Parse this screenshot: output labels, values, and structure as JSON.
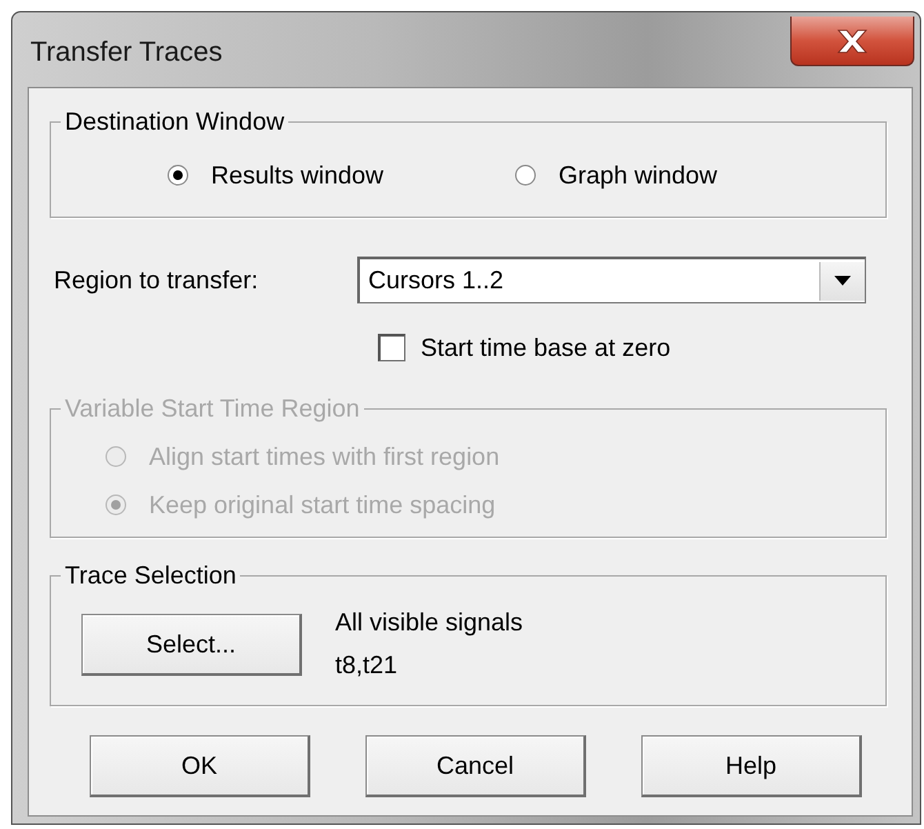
{
  "window": {
    "title": "Transfer Traces"
  },
  "destination_window": {
    "title": "Destination Window",
    "options": [
      {
        "label": "Results window",
        "selected": true
      },
      {
        "label": "Graph window",
        "selected": false
      }
    ]
  },
  "region": {
    "label": "Region to transfer:",
    "value": "Cursors 1..2"
  },
  "start_at_zero": {
    "label": "Start time base at zero",
    "checked": false
  },
  "variable_start": {
    "title": "Variable Start Time Region",
    "disabled": true,
    "options": [
      {
        "label": "Align start times with first region",
        "selected": false
      },
      {
        "label": "Keep original start time spacing",
        "selected": true
      }
    ]
  },
  "trace_selection": {
    "title": "Trace Selection",
    "button": "Select...",
    "description": "All visible signals",
    "traces": "t8,t21"
  },
  "buttons": [
    "OK",
    "Cancel",
    "Help"
  ]
}
